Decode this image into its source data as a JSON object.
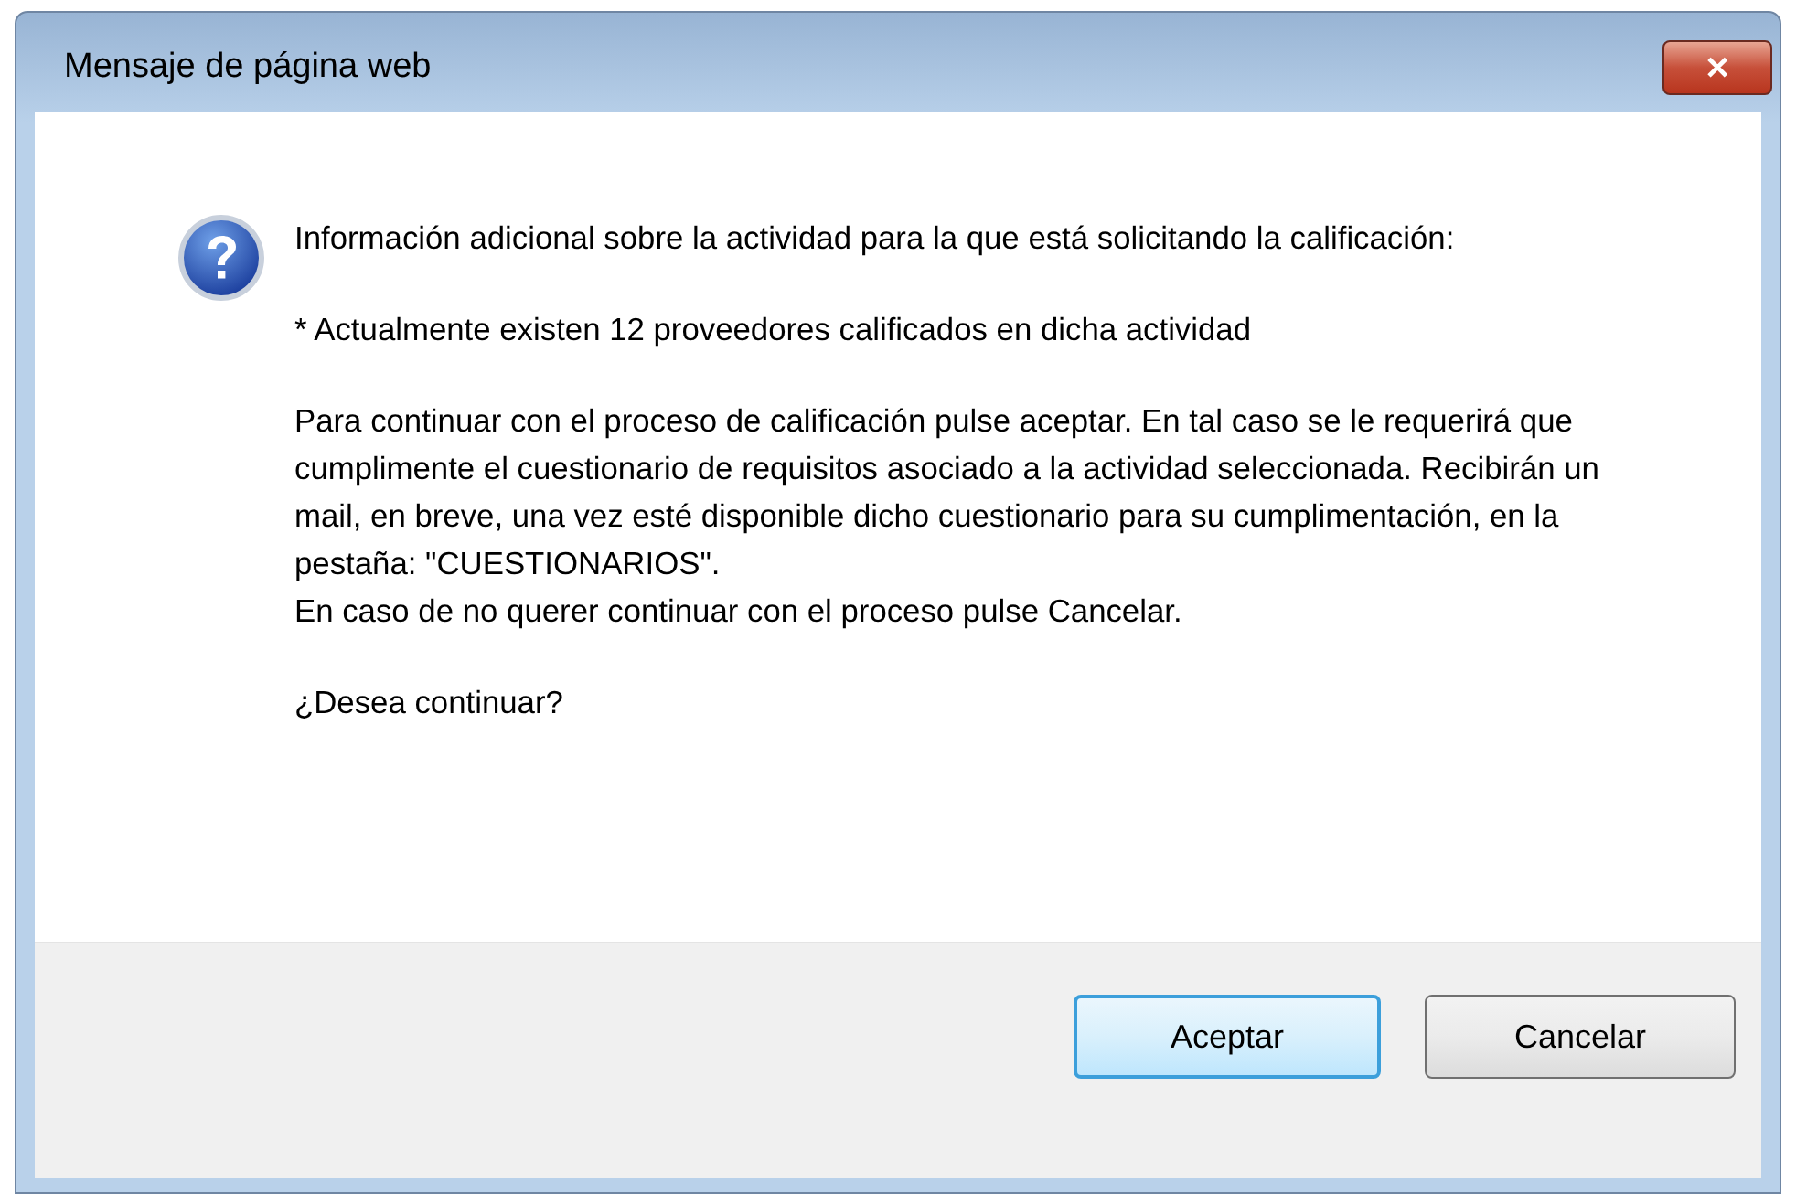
{
  "window": {
    "title": "Mensaje de página web",
    "close_label": "✕"
  },
  "message": {
    "paragraphs": [
      [
        "Información adicional sobre la actividad para la que está solicitando la calificación:"
      ],
      [
        "* Actualmente existen 12 proveedores calificados en dicha actividad"
      ],
      [
        "Para continuar con el proceso de calificación pulse aceptar. En tal caso se le requerirá que cumplimente el cuestionario de requisitos asociado a la actividad seleccionada. Recibirán un mail, en breve, una vez esté disponible dicho cuestionario para su cumplimentación, en la pestaña: \"CUESTIONARIOS\".",
        "En caso de no querer continuar con el proceso pulse Cancelar."
      ],
      [
        "¿Desea continuar?"
      ]
    ]
  },
  "buttons": [
    {
      "label": "Aceptar",
      "default": true
    },
    {
      "label": "Cancelar",
      "default": false
    }
  ]
}
